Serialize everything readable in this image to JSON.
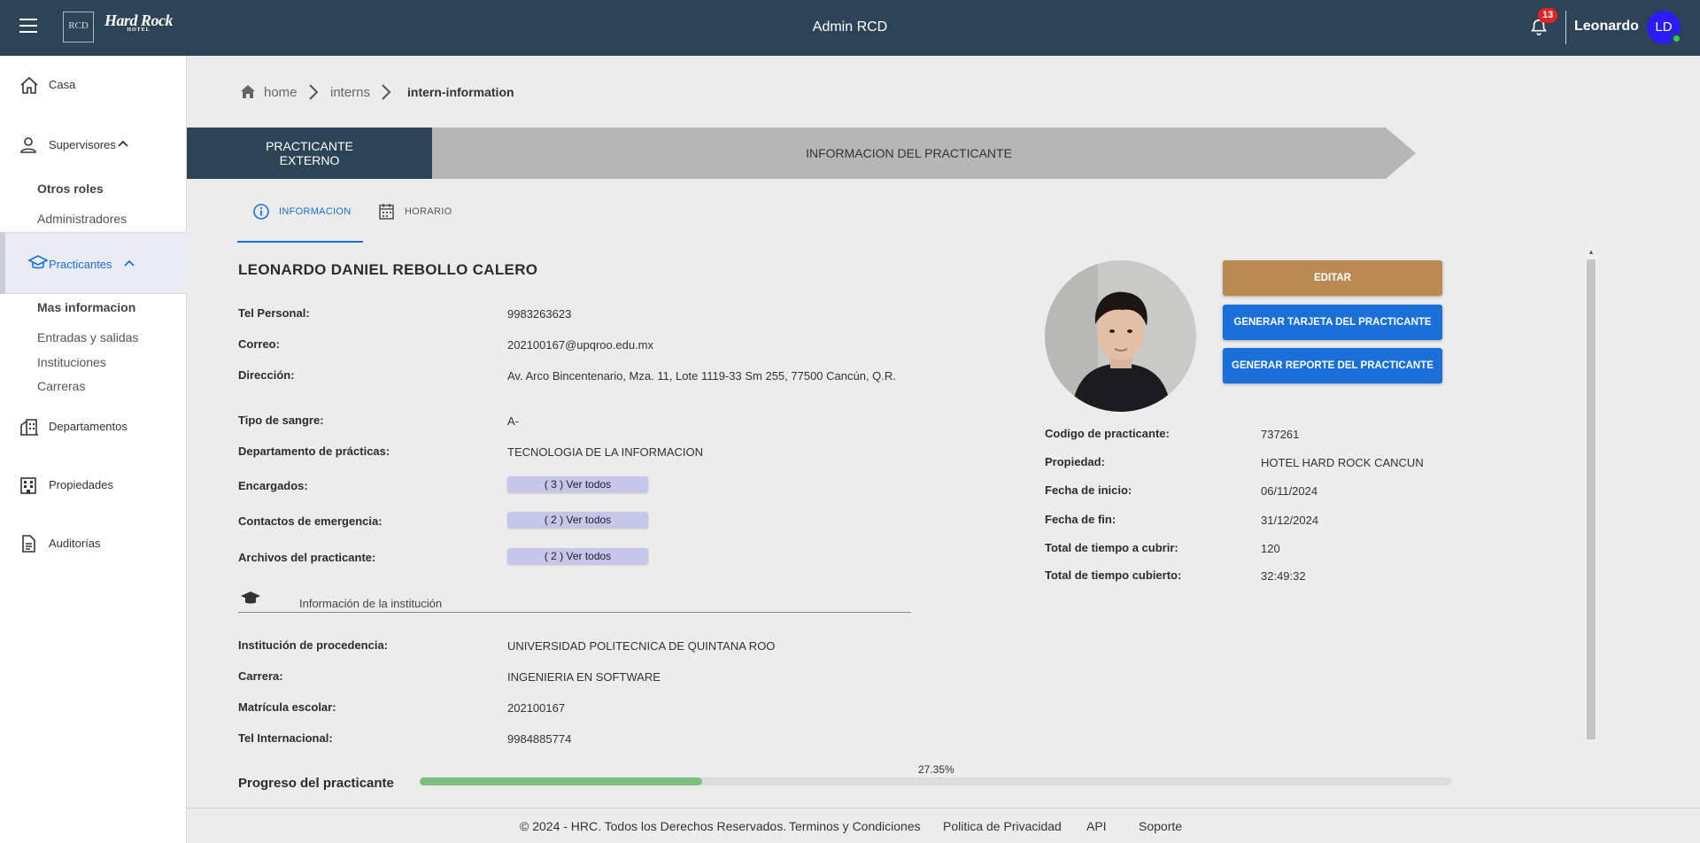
{
  "header": {
    "app_title": "Admin RCD",
    "logo_rcd": "RCD",
    "logo_hardrock": "Hard Rock",
    "logo_hotel": "HOTEL",
    "notification_count": "13",
    "user_name": "Leonardo",
    "user_initials": "LD"
  },
  "sidebar": {
    "casa": "Casa",
    "supervisores": "Supervisores",
    "otros_roles": "Otros roles",
    "administradores": "Administradores",
    "practicantes": "Practicantes",
    "mas_informacion": "Mas informacion",
    "entradas_salidas": "Entradas y salidas",
    "instituciones": "Instituciones",
    "carreras": "Carreras",
    "departamentos": "Departamentos",
    "propiedades": "Propiedades",
    "auditorias": "Auditorías"
  },
  "breadcrumb": [
    "home",
    "interns",
    "intern-information"
  ],
  "stepper": {
    "step1_line1": "PRACTICANTE",
    "step1_line2": "EXTERNO",
    "step2": "INFORMACION DEL PRACTICANTE"
  },
  "tabs": [
    "INFORMACION",
    "HORARIO"
  ],
  "intern": {
    "name": "LEONARDO DANIEL REBOLLO CALERO",
    "fields": [
      {
        "label": "Tel Personal:",
        "value": "9983263623"
      },
      {
        "label": "Correo:",
        "value": "202100167@upqroo.edu.mx"
      },
      {
        "label": "Dirección:",
        "value": "Av. Arco Bincentenario, Mza. 11, Lote 1119-33 Sm 255, 77500 Cancún, Q.R."
      },
      {
        "label": "Tipo de sangre:",
        "value": "A-"
      },
      {
        "label": "Departamento de prácticas:",
        "value": "TECNOLOGIA DE LA INFORMACION"
      }
    ],
    "links": [
      {
        "label": "Encargados:",
        "value": "( 3 ) Ver todos"
      },
      {
        "label": "Contactos de emergencia:",
        "value": "( 2 ) Ver todos"
      },
      {
        "label": "Archivos del practicante:",
        "value": "( 2 ) Ver todos"
      }
    ]
  },
  "institution": {
    "header": "Información de la institución",
    "fields": [
      {
        "label": "Institución de procedencia:",
        "value": "UNIVERSIDAD POLITECNICA DE QUINTANA ROO"
      },
      {
        "label": "Carrera:",
        "value": "INGENIERIA EN SOFTWARE"
      },
      {
        "label": "Matrícula escolar:",
        "value": "202100167"
      },
      {
        "label": "Tel Internacional:",
        "value": "9984885774"
      }
    ]
  },
  "buttons": {
    "edit": "EDITAR",
    "generate_card": "GENERAR TARJETA DEL PRACTICANTE",
    "generate_report": "GENERAR REPORTE DEL PRACTICANTE"
  },
  "summary": [
    {
      "label": "Codigo de practicante:",
      "value": "737261"
    },
    {
      "label": "Propiedad:",
      "value": "HOTEL HARD ROCK CANCUN"
    },
    {
      "label": "Fecha de inicio:",
      "value": "06/11/2024"
    },
    {
      "label": "Fecha de fin:",
      "value": "31/12/2024"
    },
    {
      "label": "Total de tiempo a cubrir:",
      "value": "120"
    },
    {
      "label": "Total de tiempo cubierto:",
      "value": "32:49:32"
    }
  ],
  "progress": {
    "label": "Progreso del practicante",
    "percent_text": "27.35%",
    "fraction": 0.2735
  },
  "footer": [
    "© 2024 - HRC. Todos los Derechos Reservados.",
    "Terminos y Condiciones",
    "Politica de Privacidad",
    "API",
    "Soporte"
  ],
  "colors": {
    "topbar": "#2d4356",
    "accent": "#1a6fd8",
    "edit_button": "#b98b52",
    "progress_fill": "#7cbf81"
  }
}
